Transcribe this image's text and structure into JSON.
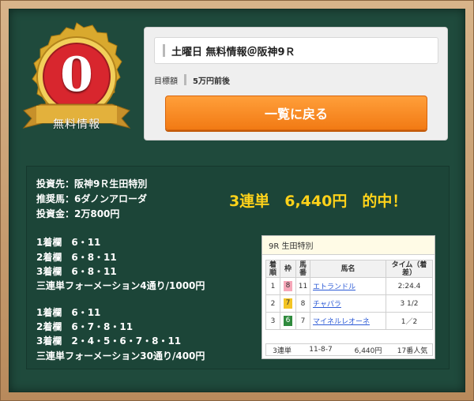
{
  "medal": {
    "number": "0",
    "label": "無料情報"
  },
  "card": {
    "title": "土曜日 無料情報＠阪神9Ｒ",
    "target_label": "目標額",
    "target_value": "5万円前後",
    "back_button": "一覧に戻る"
  },
  "bet": {
    "line1": "投資先：阪神9Ｒ生田特別",
    "line2": "推奨馬：6ダノンアローダ",
    "line3": "投資金：2万800円",
    "hit": "3連単　6,440円　的中！",
    "set1": [
      "1着欄　6・11",
      "2着欄　6・8・11",
      "3着欄　6・8・11",
      "三連単フォーメーション4通り/1000円"
    ],
    "set2": [
      "1着欄　6・11",
      "2着欄　6・7・8・11",
      "3着欄　2・4・5・6・7・8・11",
      "三連単フォーメーション30通り/400円"
    ]
  },
  "result": {
    "race": "9R 生田特別",
    "headers": [
      "着順",
      "枠",
      "馬番",
      "馬名",
      "タイム（着差）"
    ],
    "rows": [
      {
        "rank": "1",
        "frame": "8",
        "number": "11",
        "name": "エトランドル",
        "time": "2:24.4"
      },
      {
        "rank": "2",
        "frame": "7",
        "number": "8",
        "name": "チャパラ",
        "time": "3 1/2"
      },
      {
        "rank": "3",
        "frame": "6",
        "number": "7",
        "name": "マイネルレオーネ",
        "time": "1／2"
      }
    ],
    "payout": {
      "type": "3連単",
      "combo": "11-8-7",
      "amount": "6,440円",
      "popularity": "17番人気"
    }
  },
  "colors": {
    "board": "#1f4a3c",
    "accent": "#f27a14",
    "hit": "#ffd21a",
    "frame8": "#f6a6b8",
    "frame7": "#f3c423",
    "frame6": "#2f8a3d"
  }
}
